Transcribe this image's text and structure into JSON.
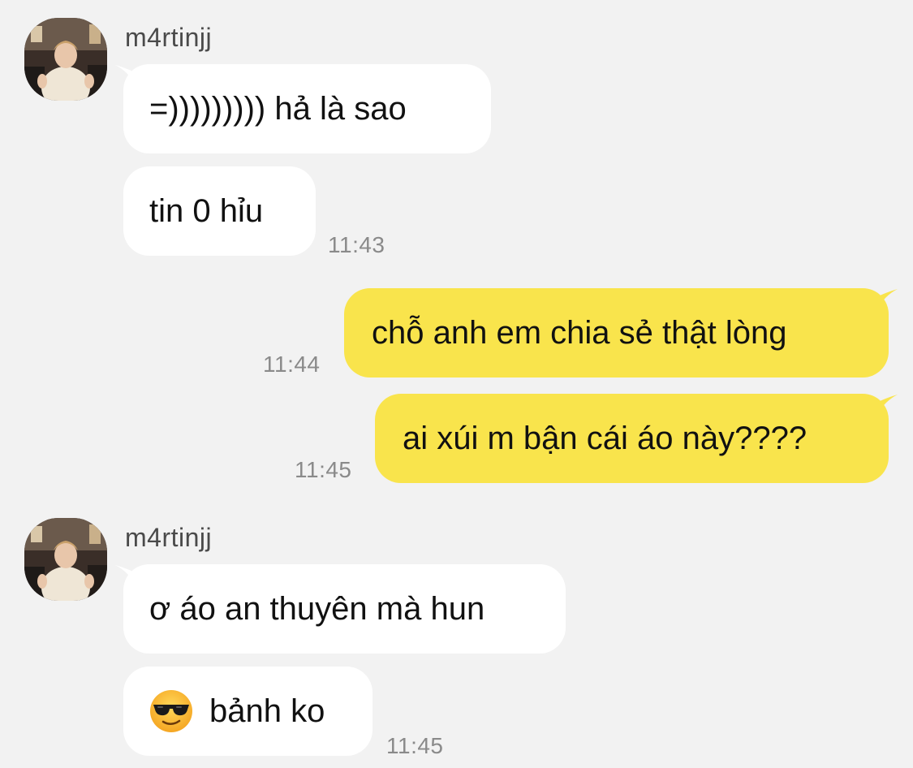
{
  "messages": [
    {
      "sender": "m4rtinjj",
      "bubbles": [
        "=))))))))) hả là sao",
        "tin 0 hỉu"
      ],
      "time": "11:43"
    },
    {
      "outgoing": [
        {
          "text": "chỗ anh em chia sẻ thật lòng",
          "time": "11:44"
        },
        {
          "text": "ai xúi m bận cái áo này????",
          "time": "11:45"
        }
      ]
    },
    {
      "sender": "m4rtinjj",
      "bubbles": [
        "ơ áo an thuyên mà hun",
        "bảnh ko"
      ],
      "emoji": "sunglasses-face-emoji",
      "time": "11:45"
    }
  ],
  "colors": {
    "background": "#f2f2f2",
    "incoming_bubble": "#ffffff",
    "outgoing_bubble": "#f9e44c",
    "timestamp": "#8a8a8a"
  }
}
